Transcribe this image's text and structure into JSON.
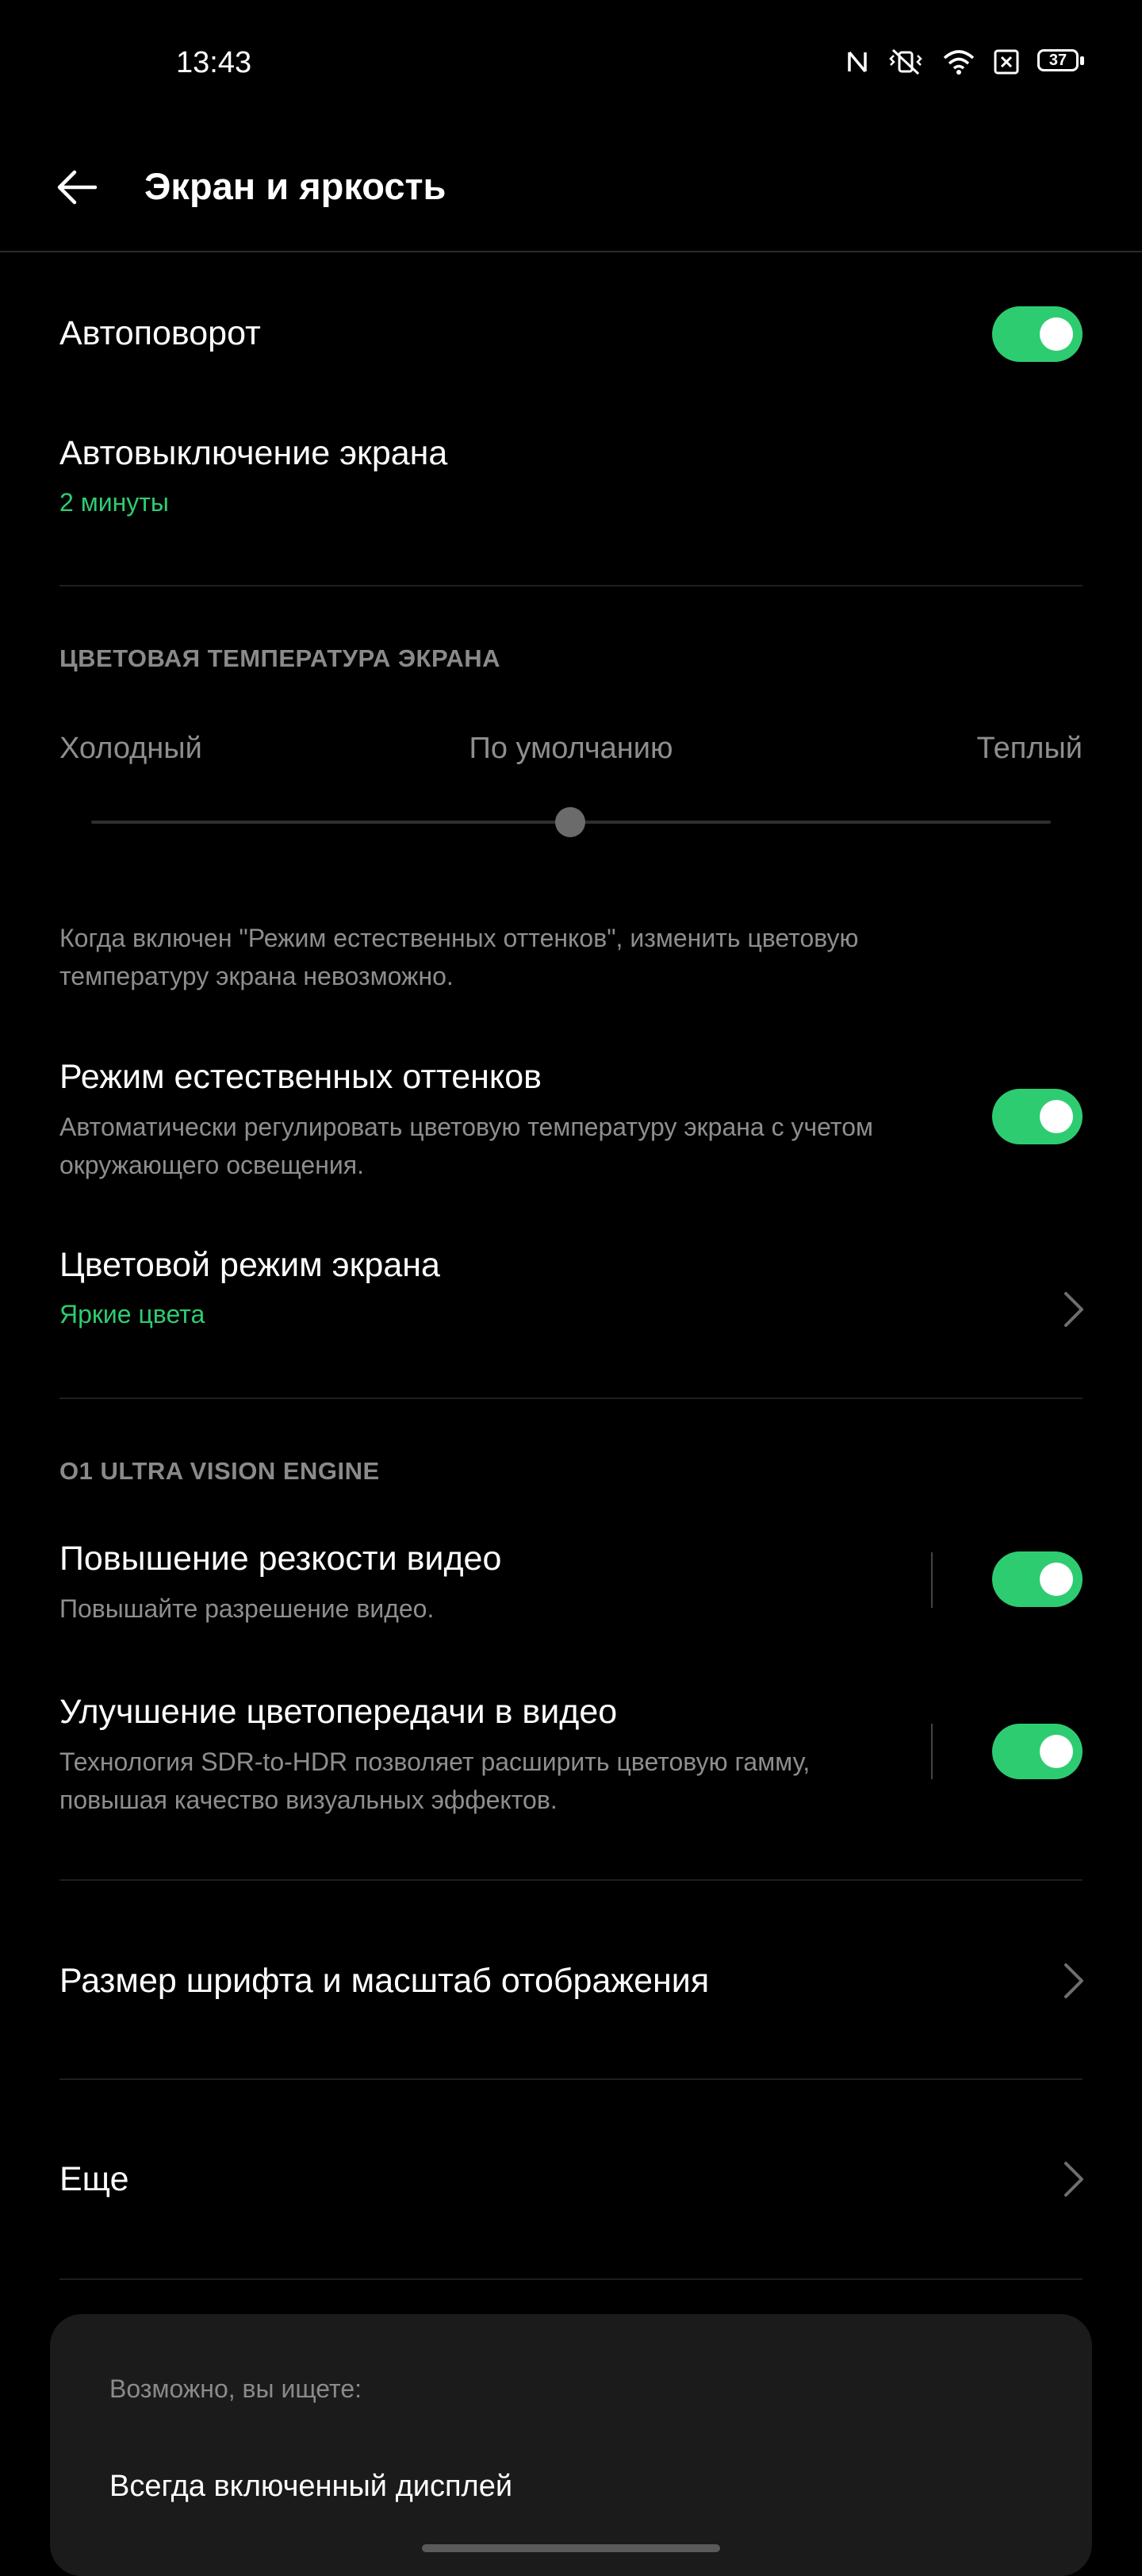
{
  "status_bar": {
    "time": "13:43",
    "battery": "37"
  },
  "header": {
    "title": "Экран и яркость"
  },
  "autorotate": {
    "label": "Автоповорот",
    "on": true
  },
  "screen_timeout": {
    "label": "Автовыключение экрана",
    "value": "2 минуты"
  },
  "color_temp": {
    "section": "ЦВЕТОВАЯ ТЕМПЕРАТУРА ЭКРАНА",
    "cold": "Холодный",
    "default": "По умолчанию",
    "warm": "Теплый",
    "level": 0.5,
    "note_line1": "Когда включен \"Режим естественных оттенков\", изменить цветовую",
    "note_line2": "температуру экрана невозможно."
  },
  "natural_tone": {
    "label": "Режим естественных оттенков",
    "desc_line1": "Автоматически регулировать цветовую температуру экрана с учетом",
    "desc_line2": "окружающего освещения.",
    "on": true
  },
  "color_mode": {
    "label": "Цветовой режим экрана",
    "value": "Яркие цвета"
  },
  "engine": {
    "section": "O1 ULTRA VISION ENGINE",
    "sharpness": {
      "label": "Повышение резкости видео",
      "desc": "Повышайте разрешение видео.",
      "on": true
    },
    "color_enh": {
      "label": "Улучшение цветопередачи в видео",
      "desc_line1": "Технология SDR-to-HDR позволяет расширить цветовую гамму,",
      "desc_line2": "повышая качество визуальных эффектов.",
      "on": true
    }
  },
  "font_size": {
    "label": "Размер шрифта и масштаб отображения"
  },
  "more": {
    "label": "Еще"
  },
  "suggest": {
    "heading": "Возможно, вы ищете:",
    "item": "Всегда включенный дисплей"
  },
  "colors": {
    "accent": "#2ecc71",
    "background": "#000000",
    "card": "#1b1b1b"
  }
}
